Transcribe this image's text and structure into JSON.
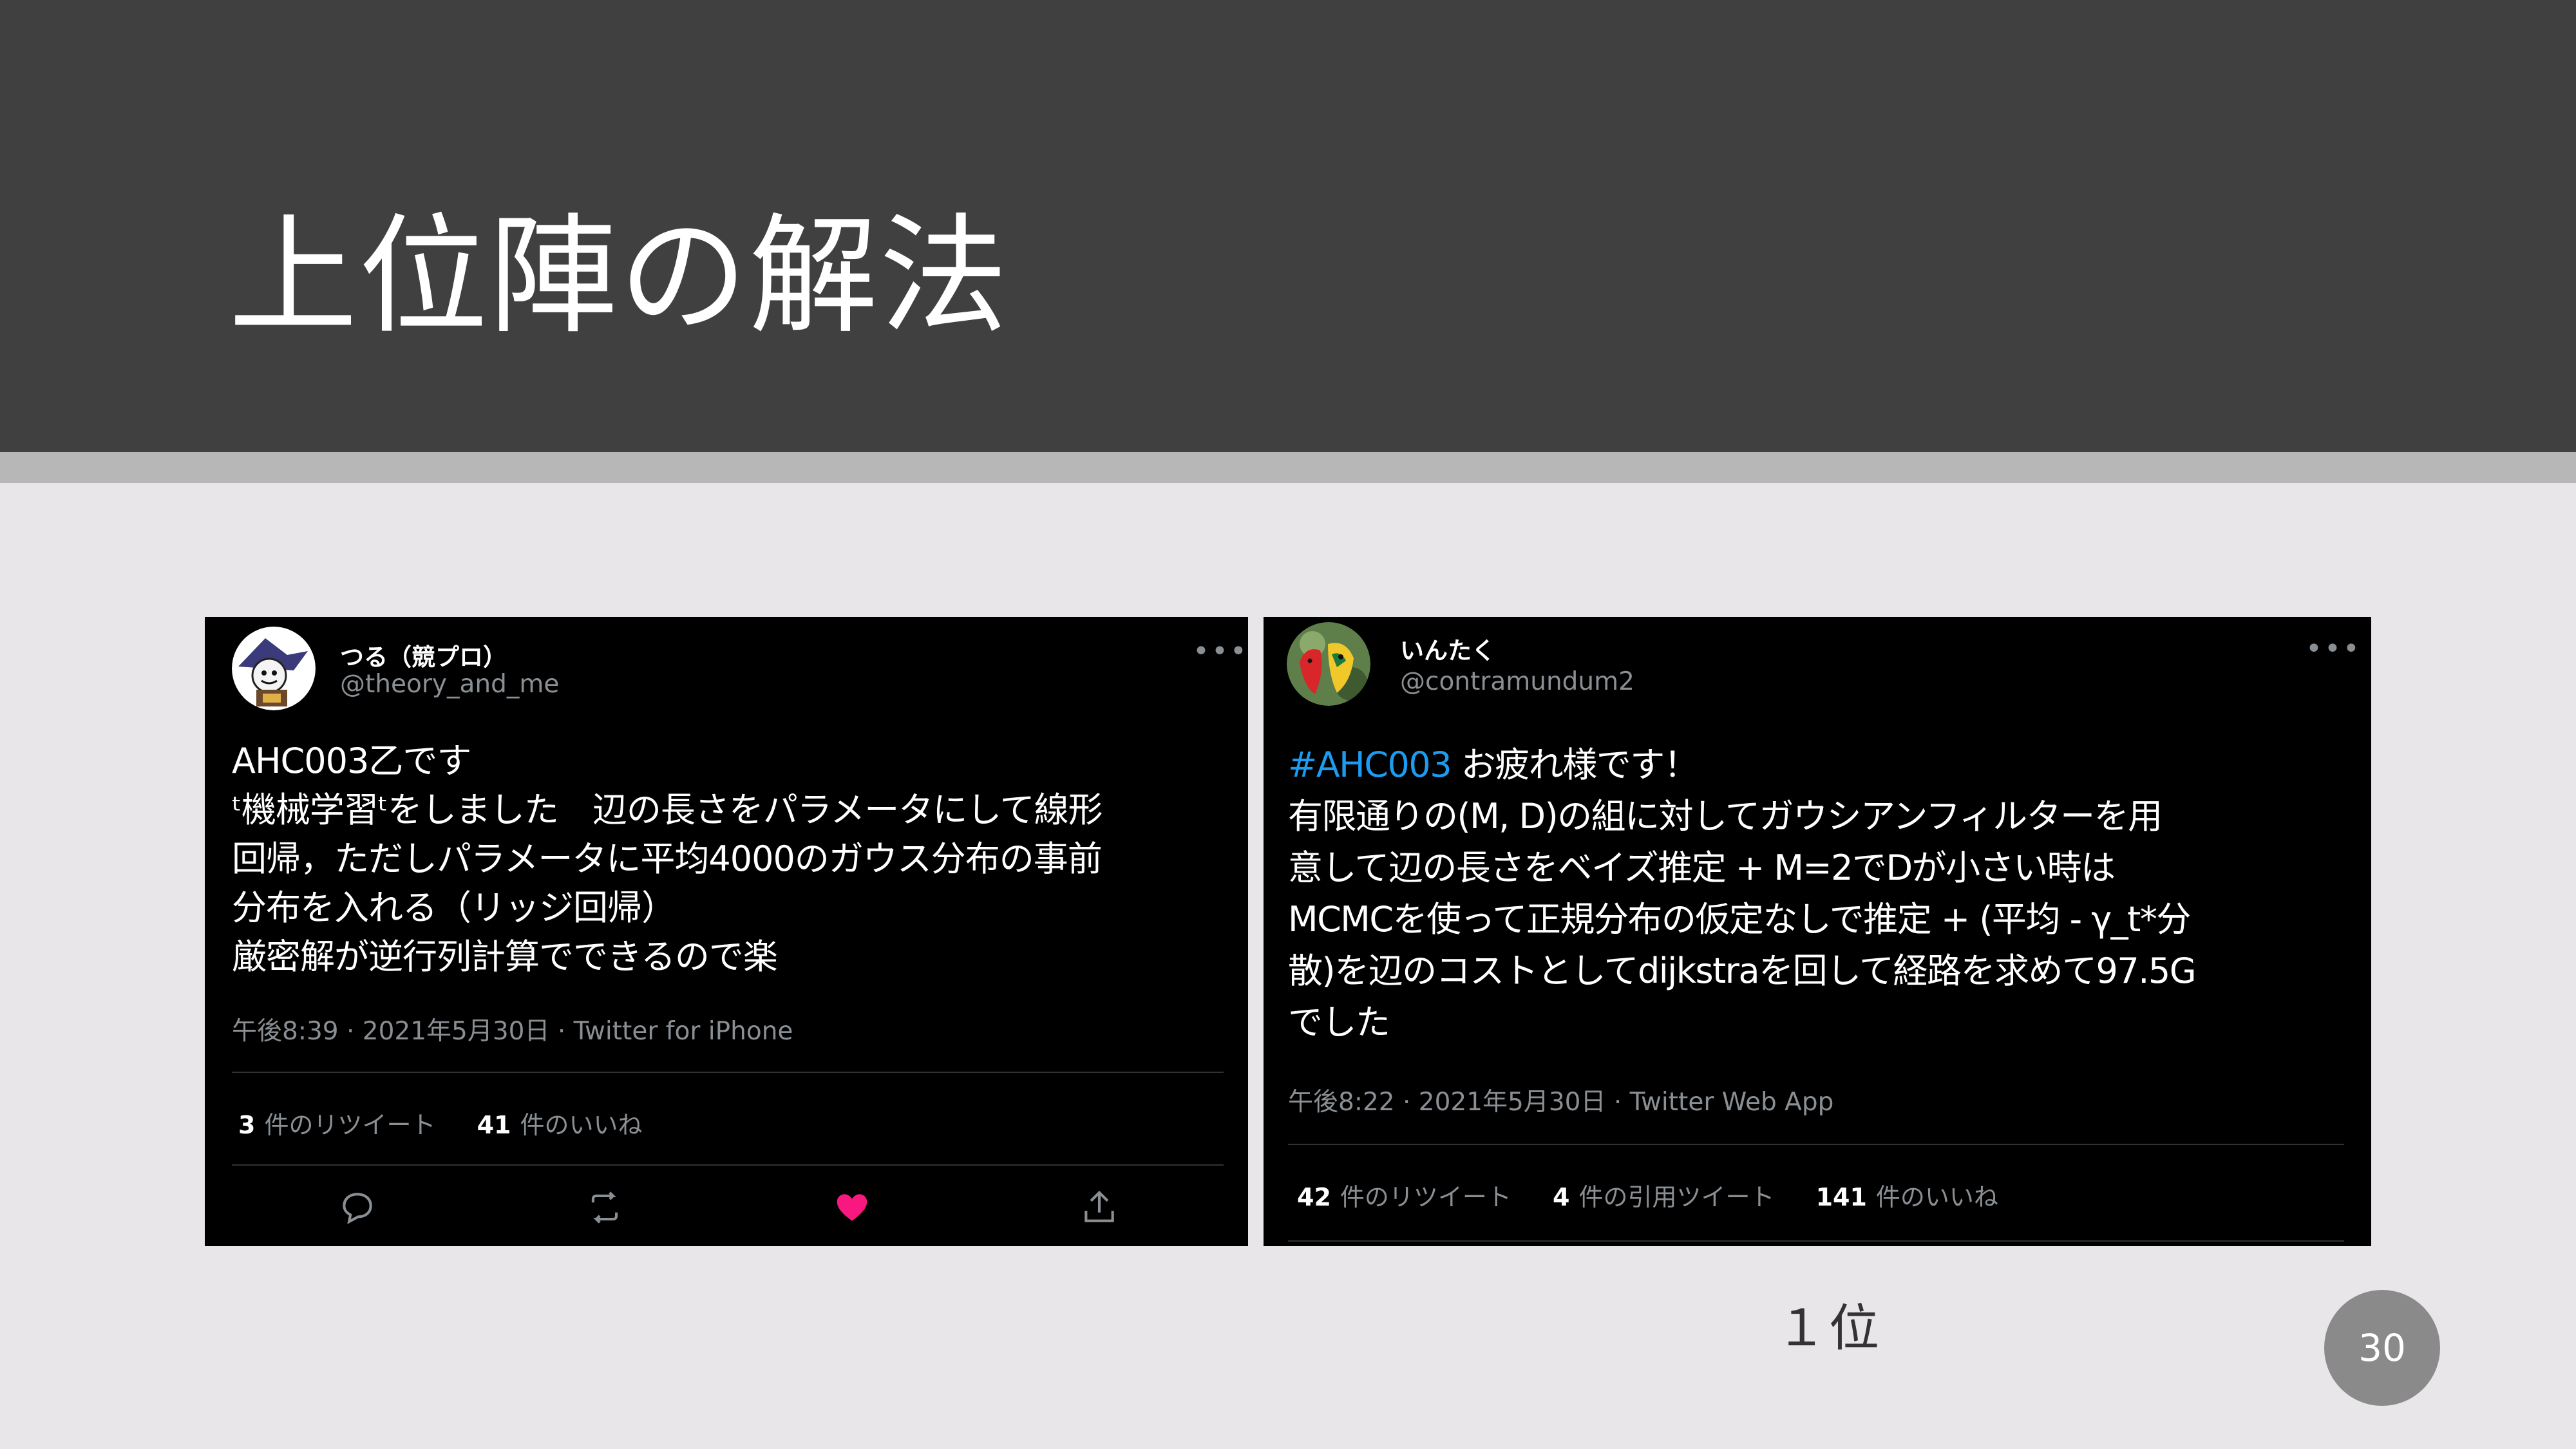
{
  "slide": {
    "title": "上位陣の解法",
    "rank_label": "１位",
    "page_number": "30"
  },
  "tweets": [
    {
      "display_name": "つる（競プロ）",
      "handle": "@theory_and_me",
      "more_icon": "more-horizontal-icon",
      "body_lines": [
        "AHC003乙です",
        "ᵗ機械学習ᵗをしました　辺の長さをパラメータにして線形",
        "回帰，ただしパラメータに平均4000のガウス分布の事前",
        "分布を入れる（リッジ回帰）",
        "厳密解が逆行列計算でできるので楽"
      ],
      "meta": "午後8:39 · 2021年5月30日 · Twitter for iPhone",
      "stats": [
        {
          "count": "3",
          "label": "件のリツイート"
        },
        {
          "count": "41",
          "label": "件のいいね"
        }
      ],
      "actions": [
        "reply-icon",
        "retweet-icon",
        "heart-filled-icon",
        "share-icon"
      ],
      "like_color": "#f91880"
    },
    {
      "display_name": "いんたく",
      "handle": "@contramundum2",
      "more_icon": "more-horizontal-icon",
      "hashtag": "#AHC003",
      "hashtag_color": "#1d9bf0",
      "first_line_rest": " お疲れ様です！",
      "body_lines": [
        "有限通りの(M, D)の組に対してガウシアンフィルターを用",
        "意して辺の長さをベイズ推定 + M=2でDが小さい時は",
        "MCMCを使って正規分布の仮定なしで推定 + (平均 - γ_t*分",
        "散)を辺のコストとしてdijkstraを回して経路を求めて97.5G",
        "でした"
      ],
      "meta": "午後8:22 · 2021年5月30日 · Twitter Web App",
      "stats": [
        {
          "count": "42",
          "label": "件のリツイート"
        },
        {
          "count": "4",
          "label": "件の引用ツイート"
        },
        {
          "count": "141",
          "label": "件のいいね"
        }
      ]
    }
  ],
  "colors": {
    "header_band": "#404040",
    "divider_strip": "#b7b7b7",
    "slide_background": "#e8e6e8",
    "tweet_background": "#000000",
    "page_number_circle": "#8a8a8a"
  }
}
